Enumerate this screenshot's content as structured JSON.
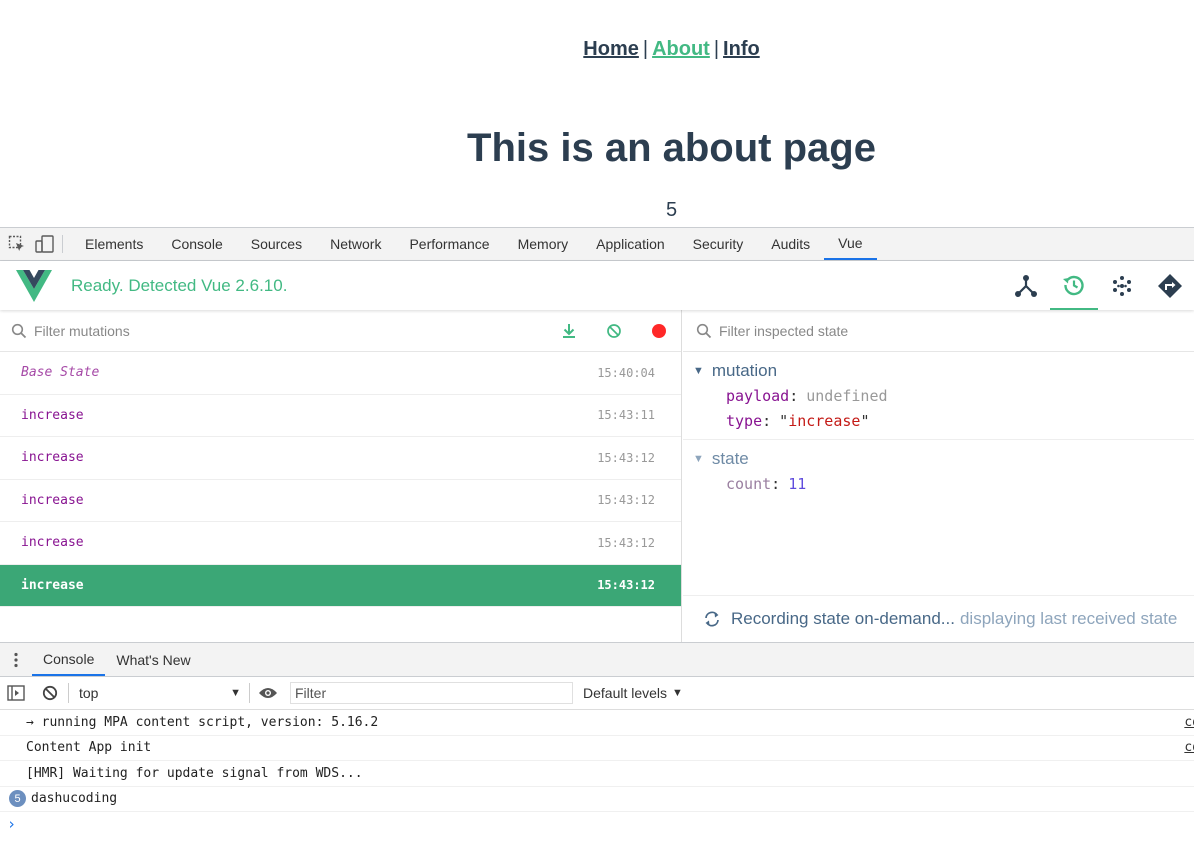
{
  "page": {
    "nav": [
      {
        "label": "Home",
        "active": false
      },
      {
        "label": "About",
        "active": true
      },
      {
        "label": "Info",
        "active": false
      }
    ],
    "separator": "|",
    "title": "This is an about page",
    "count": "5"
  },
  "devtools": {
    "tabs": [
      "Elements",
      "Console",
      "Sources",
      "Network",
      "Performance",
      "Memory",
      "Application",
      "Security",
      "Audits",
      "Vue"
    ],
    "active_tab": "Vue"
  },
  "vue": {
    "status": "Ready. Detected Vue 2.6.10.",
    "actions": [
      "components-icon",
      "history-icon",
      "events-icon",
      "routing-icon"
    ],
    "accent": "#42b983"
  },
  "mutations": {
    "filter_placeholder": "Filter mutations",
    "rows": [
      {
        "name": "Base State",
        "time": "15:40:04"
      },
      {
        "name": "increase",
        "time": "15:43:11"
      },
      {
        "name": "increase",
        "time": "15:43:12"
      },
      {
        "name": "increase",
        "time": "15:43:12"
      },
      {
        "name": "increase",
        "time": "15:43:12"
      },
      {
        "name": "increase",
        "time": "15:43:12"
      }
    ],
    "selected_index": 5
  },
  "inspector": {
    "filter_placeholder": "Filter inspected state",
    "mutation_title": "mutation",
    "payload_key": "payload",
    "payload_value": "undefined",
    "type_key": "type",
    "type_value": "increase",
    "state_title": "state",
    "count_key": "count",
    "count_value": "11",
    "recording_main": "Recording state on-demand...",
    "recording_sub": "displaying last received state"
  },
  "drawer": {
    "tabs": [
      "Console",
      "What's New"
    ],
    "active_tab": "Console",
    "context": "top",
    "filter_placeholder": "Filter",
    "levels": "Default levels",
    "messages": [
      {
        "text": "→ running MPA content script, version: 5.16.2",
        "source": "co"
      },
      {
        "text": "Content App init",
        "source": "co"
      },
      {
        "text": "[HMR] Waiting for update signal from WDS...",
        "source": ""
      },
      {
        "text": "dashucoding",
        "count": "5",
        "source": ""
      }
    ]
  }
}
